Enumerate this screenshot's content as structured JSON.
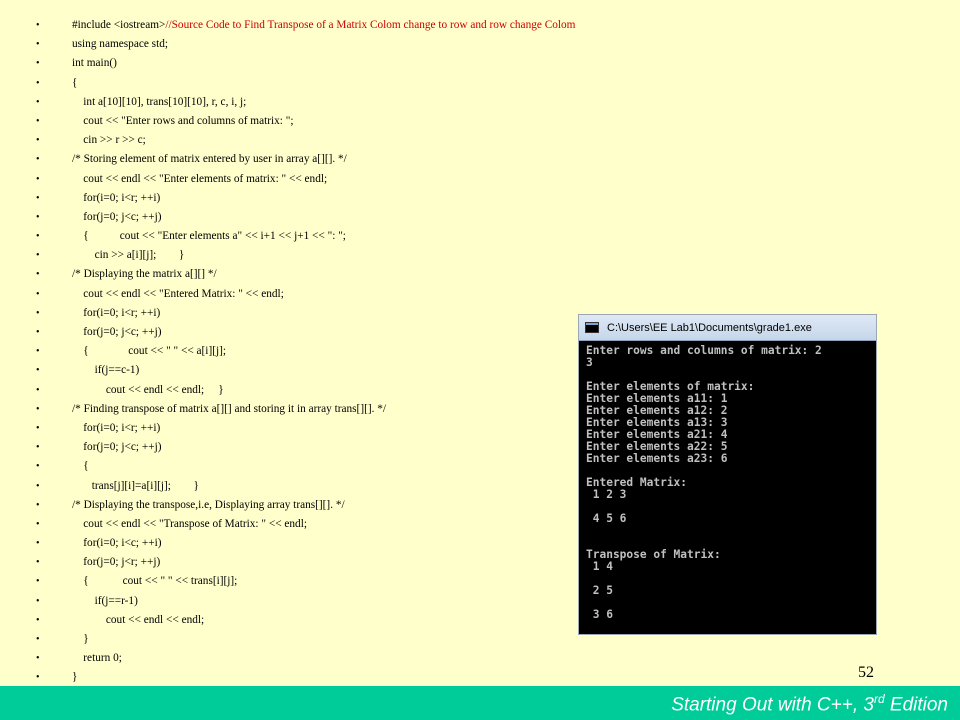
{
  "code_lines": [
    {
      "code": "#include <iostream>",
      "comment": "//Source Code to Find Transpose of a Matrix Colom change to row and row change Colom"
    },
    {
      "code": "using namespace std;",
      "comment": ""
    },
    {
      "code": "int main()",
      "comment": ""
    },
    {
      "code": "{",
      "comment": ""
    },
    {
      "code": "    int a[10][10], trans[10][10], r, c, i, j;",
      "comment": ""
    },
    {
      "code": "    cout << \"Enter rows and columns of matrix: \";",
      "comment": ""
    },
    {
      "code": "    cin >> r >> c;",
      "comment": ""
    },
    {
      "code": "/* Storing element of matrix entered by user in array a[][]. */",
      "comment": ""
    },
    {
      "code": "    cout << endl << \"Enter elements of matrix: \" << endl;",
      "comment": ""
    },
    {
      "code": "    for(i=0; i<r; ++i)",
      "comment": ""
    },
    {
      "code": "    for(j=0; j<c; ++j)",
      "comment": ""
    },
    {
      "code": "    {           cout << \"Enter elements a\" << i+1 << j+1 << \": \";",
      "comment": ""
    },
    {
      "code": "        cin >> a[i][j];        }",
      "comment": ""
    },
    {
      "code": "/* Displaying the matrix a[][] */",
      "comment": ""
    },
    {
      "code": "    cout << endl << \"Entered Matrix: \" << endl;",
      "comment": ""
    },
    {
      "code": "    for(i=0; i<r; ++i)",
      "comment": ""
    },
    {
      "code": "    for(j=0; j<c; ++j)",
      "comment": ""
    },
    {
      "code": "    {              cout << \" \" << a[i][j];",
      "comment": ""
    },
    {
      "code": "        if(j==c-1)",
      "comment": ""
    },
    {
      "code": "            cout << endl << endl;     }",
      "comment": ""
    },
    {
      "code": "/* Finding transpose of matrix a[][] and storing it in array trans[][]. */",
      "comment": ""
    },
    {
      "code": "    for(i=0; i<r; ++i)",
      "comment": ""
    },
    {
      "code": "    for(j=0; j<c; ++j)",
      "comment": ""
    },
    {
      "code": "    {",
      "comment": ""
    },
    {
      "code": "       trans[j][i]=a[i][j];        }",
      "comment": ""
    },
    {
      "code": "/* Displaying the transpose,i.e, Displaying array trans[][]. */",
      "comment": ""
    },
    {
      "code": "    cout << endl << \"Transpose of Matrix: \" << endl;",
      "comment": ""
    },
    {
      "code": "    for(i=0; i<c; ++i)",
      "comment": ""
    },
    {
      "code": "    for(j=0; j<r; ++j)",
      "comment": ""
    },
    {
      "code": "    {            cout << \" \" << trans[i][j];",
      "comment": ""
    },
    {
      "code": "        if(j==r-1)",
      "comment": ""
    },
    {
      "code": "            cout << endl << endl;",
      "comment": ""
    },
    {
      "code": "    }",
      "comment": ""
    },
    {
      "code": "    return 0;",
      "comment": ""
    },
    {
      "code": "}",
      "comment": ""
    }
  ],
  "bullet_char": "•",
  "console": {
    "title": "C:\\Users\\EE Lab1\\Documents\\grade1.exe",
    "icon": "console-window-icon",
    "lines": [
      "Enter rows and columns of matrix: 2",
      "3",
      "",
      "Enter elements of matrix:",
      "Enter elements a11: 1",
      "Enter elements a12: 2",
      "Enter elements a13: 3",
      "Enter elements a21: 4",
      "Enter elements a22: 5",
      "Enter elements a23: 6",
      "",
      "Entered Matrix:",
      " 1 2 3",
      "",
      " 4 5 6",
      "",
      "",
      "Transpose of Matrix:",
      " 1 4",
      "",
      " 2 5",
      "",
      " 3 6"
    ]
  },
  "page_number": "52",
  "footer": {
    "text_before": "Starting Out with C++, 3",
    "sup": "rd",
    "text_after": " Edition"
  },
  "colors": {
    "background": "#ffffcc",
    "footer_bar": "#00cc99",
    "comment": "#cc0000",
    "console_bg": "#000000",
    "console_text": "#c0c0c0"
  }
}
